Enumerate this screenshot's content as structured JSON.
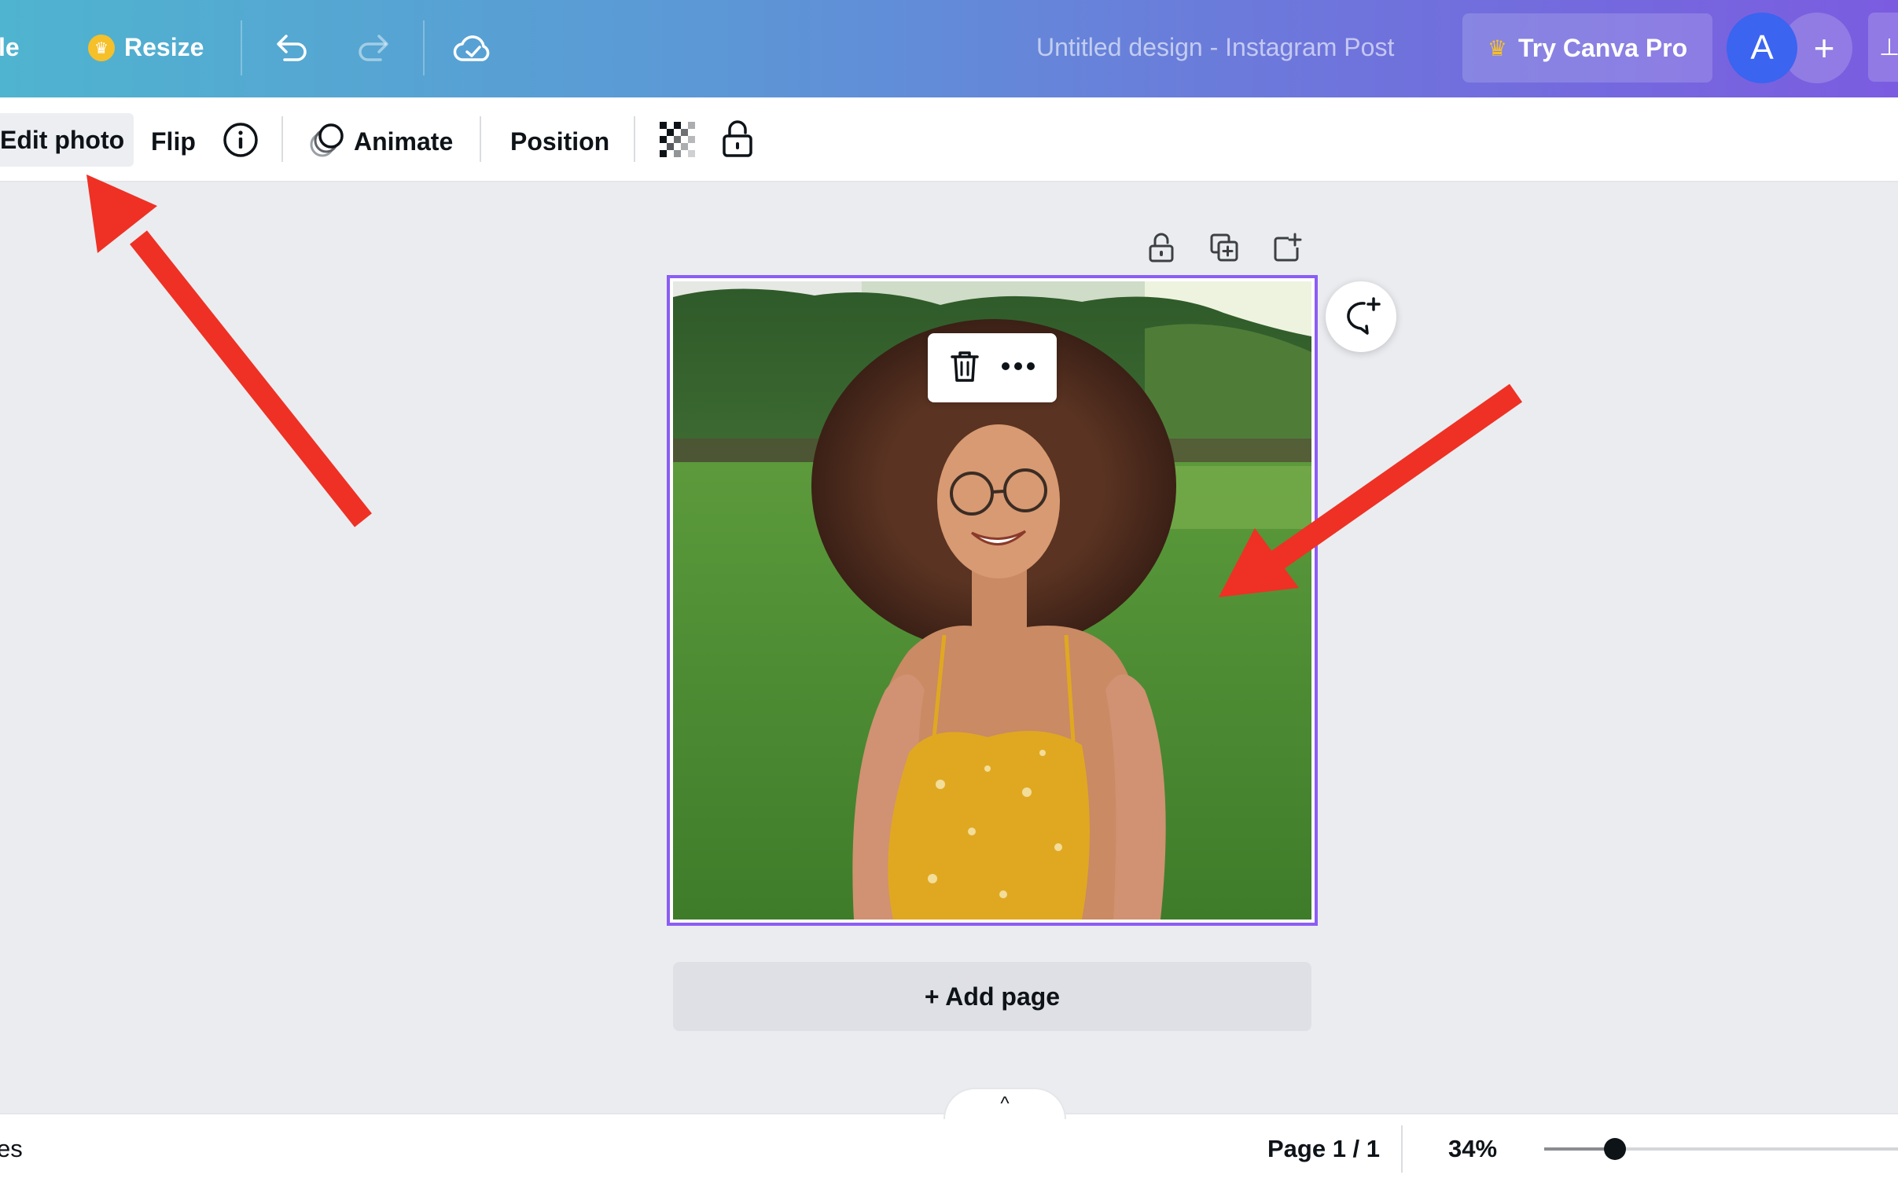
{
  "header": {
    "file_label_partial": "le",
    "resize_label": "Resize",
    "design_title": "Untitled design - Instagram Post",
    "try_pro_label": "Try Canva Pro",
    "avatar_initial": "A",
    "add_icon_glyph": "+",
    "share_partial": "⊥"
  },
  "toolbar": {
    "edit_photo_label": "Edit photo",
    "flip_label": "Flip",
    "animate_label": "Animate",
    "position_label": "Position"
  },
  "canvas": {
    "add_page_label": "+ Add page",
    "collapse_glyph": "^"
  },
  "footer": {
    "notes_partial": "es",
    "page_indicator": "Page 1 / 1",
    "zoom_label": "34%",
    "zoom_fraction": 0.2
  },
  "colors": {
    "accent": "#8b5cf6",
    "arrow": "#ee3124",
    "pro_crown": "#f5c02a",
    "avatar": "#3b64f0"
  }
}
